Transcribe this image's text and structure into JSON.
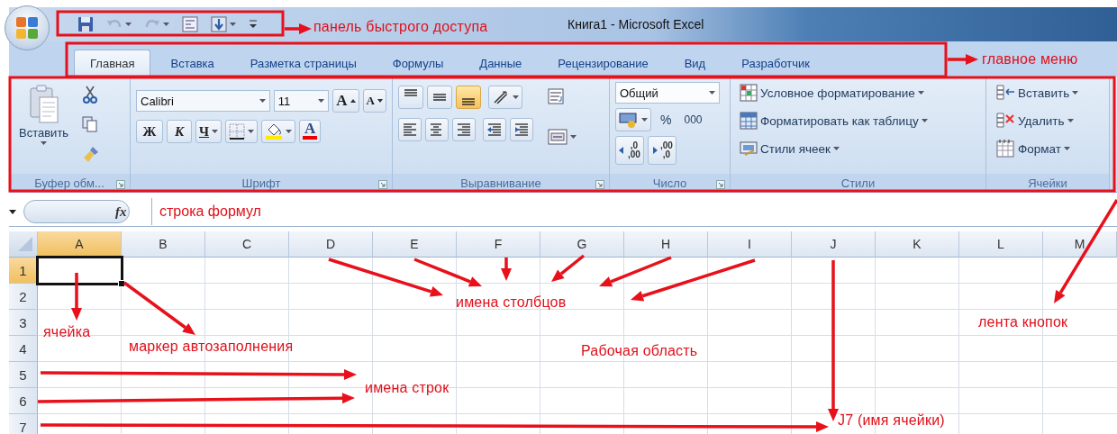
{
  "window": {
    "title": "Книга1 - Microsoft Excel"
  },
  "tabs": [
    {
      "label": "Главная",
      "selected": true
    },
    {
      "label": "Вставка",
      "selected": false
    },
    {
      "label": "Разметка страницы",
      "selected": false
    },
    {
      "label": "Формулы",
      "selected": false
    },
    {
      "label": "Данные",
      "selected": false
    },
    {
      "label": "Рецензирование",
      "selected": false
    },
    {
      "label": "Вид",
      "selected": false
    },
    {
      "label": "Разработчик",
      "selected": false
    }
  ],
  "ribbon": {
    "clipboard": {
      "title": "Буфер обм...",
      "paste": "Вставить"
    },
    "font": {
      "title": "Шрифт",
      "font_name": "Calibri",
      "font_size": "11",
      "grow": "A",
      "shrink": "A",
      "bold": "Ж",
      "italic": "К",
      "underline": "Ч",
      "font_color": "A"
    },
    "alignment": {
      "title": "Выравнивание",
      "vertical_align": [
        {
          "selected": false
        },
        {
          "selected": false
        },
        {
          "selected": true
        }
      ]
    },
    "number": {
      "title": "Число",
      "format": "Общий",
      "percent": "%",
      "thousands": "000",
      "decimals": [
        {
          "top": ",0",
          "bottom": ",00"
        },
        {
          "top": ",00",
          "bottom": ",0"
        }
      ]
    },
    "styles": {
      "title": "Стили",
      "items": [
        {
          "label": "Условное форматирование",
          "kind": "conditional"
        },
        {
          "label": "Форматировать как таблицу",
          "kind": "table"
        },
        {
          "label": "Стили ячеек",
          "kind": "cellstyle"
        }
      ]
    },
    "cells": {
      "title": "Ячейки",
      "items": [
        {
          "label": "Вставить",
          "kind": "insert"
        },
        {
          "label": "Удалить",
          "kind": "delete"
        },
        {
          "label": "Формат",
          "kind": "format"
        }
      ]
    }
  },
  "formula_bar": {
    "function_label": "fx",
    "value": "строка формул"
  },
  "grid": {
    "columns": [
      {
        "label": "A",
        "selected": true
      },
      {
        "label": "B",
        "selected": false
      },
      {
        "label": "C",
        "selected": false
      },
      {
        "label": "D",
        "selected": false
      },
      {
        "label": "E",
        "selected": false
      },
      {
        "label": "F",
        "selected": false
      },
      {
        "label": "G",
        "selected": false
      },
      {
        "label": "H",
        "selected": false
      },
      {
        "label": "I",
        "selected": false
      },
      {
        "label": "J",
        "selected": false
      },
      {
        "label": "K",
        "selected": false
      },
      {
        "label": "L",
        "selected": false
      },
      {
        "label": "M",
        "selected": false
      }
    ],
    "rows": [
      {
        "label": "1",
        "selected": true
      },
      {
        "label": "2",
        "selected": false
      },
      {
        "label": "3",
        "selected": false
      },
      {
        "label": "4",
        "selected": false
      },
      {
        "label": "5",
        "selected": false
      },
      {
        "label": "6",
        "selected": false
      },
      {
        "label": "7",
        "selected": false
      }
    ]
  },
  "annotations": [
    "панель быстрого доступа",
    "главное меню",
    "имена столбцов",
    "лента кнопок",
    "ячейка",
    "маркер автозаполнения",
    "Рабочая область",
    "имена строк",
    "J7 (имя ячейки)"
  ]
}
